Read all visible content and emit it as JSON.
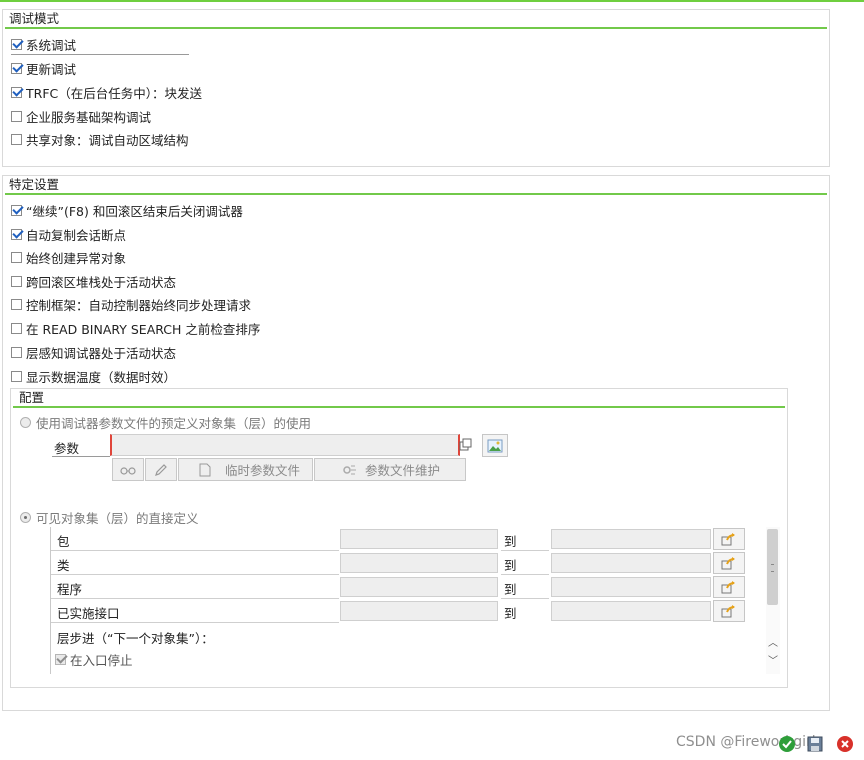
{
  "debug_mode": {
    "title": "调试模式",
    "options": [
      {
        "label": "系统调试",
        "checked": true
      },
      {
        "label": "更新调试",
        "checked": true
      },
      {
        "label": "TRFC（在后台任务中）：块发送",
        "checked": true
      },
      {
        "label": "企业服务基础架构调试",
        "checked": false
      },
      {
        "label": "共享对象：调试自动区域结构",
        "checked": false
      }
    ]
  },
  "specific_settings": {
    "title": "特定设置",
    "options": [
      {
        "label": "“继续”(F8) 和回滚区结束后关闭调试器",
        "checked": true
      },
      {
        "label": "自动复制会话断点",
        "checked": true
      },
      {
        "label": "始终创建异常对象",
        "checked": false
      },
      {
        "label": "跨回滚区堆栈处于活动状态",
        "checked": false
      },
      {
        "label": "控制框架：自动控制器始终同步处理请求",
        "checked": false
      },
      {
        "label": "在 READ BINARY SEARCH 之前检查排序",
        "checked": false
      },
      {
        "label": "层感知调试器处于活动状态",
        "checked": false
      },
      {
        "label": "显示数据温度（数据时效）",
        "checked": false
      }
    ]
  },
  "config": {
    "title": "配置",
    "radio_predefined_label": "使用调试器参数文件的预定义对象集（层）的使用",
    "param_label": "参数",
    "param_value": "",
    "temp_param_file_label": "临时参数文件",
    "param_file_maint_label": "参数文件维护",
    "radio_direct_label": "可见对象集（层）的直接定义",
    "rows": [
      {
        "label": "包",
        "to": "到",
        "from_value": "",
        "to_value": ""
      },
      {
        "label": "类",
        "to": "到",
        "from_value": "",
        "to_value": ""
      },
      {
        "label": "程序",
        "to": "到",
        "from_value": "",
        "to_value": ""
      },
      {
        "label": "已实施接口",
        "to": "到",
        "from_value": "",
        "to_value": ""
      }
    ],
    "layer_step_label": "层步进（“下一个对象集”）：",
    "stop_at_entry_label": "在入口停止"
  },
  "footer": {
    "watermark": "CSDN @Fireworkgirl"
  },
  "colors": {
    "accent_rule": "#72c94a",
    "checkmark": "#1f5fbf",
    "required_marker": "#e0453a",
    "ok_button": "#2e9e3a",
    "cancel_button": "#d8312a"
  }
}
